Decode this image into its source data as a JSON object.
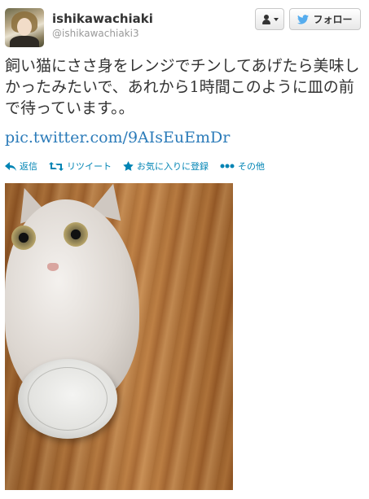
{
  "author": {
    "name": "ishikawachiaki",
    "handle": "@ishikawachiaki3"
  },
  "header_buttons": {
    "follow_label": "フォロー"
  },
  "tweet": {
    "text": "飼い猫にささ身をレンジでチンしてあげたら美味しかったみたいで、あれから1時間このように皿の前で待っています。。",
    "link": "pic.twitter.com/9AIsEuEmDr"
  },
  "actions": {
    "reply": "返信",
    "retweet": "リツイート",
    "favorite": "お気に入りに登録",
    "more": "その他"
  },
  "colors": {
    "link": "#2b7bb9",
    "action": "#0084b4",
    "twitter_bird": "#55acee"
  },
  "icons": [
    "user-icon",
    "twitter-bird-icon",
    "reply-icon",
    "retweet-icon",
    "star-icon",
    "more-icon"
  ]
}
